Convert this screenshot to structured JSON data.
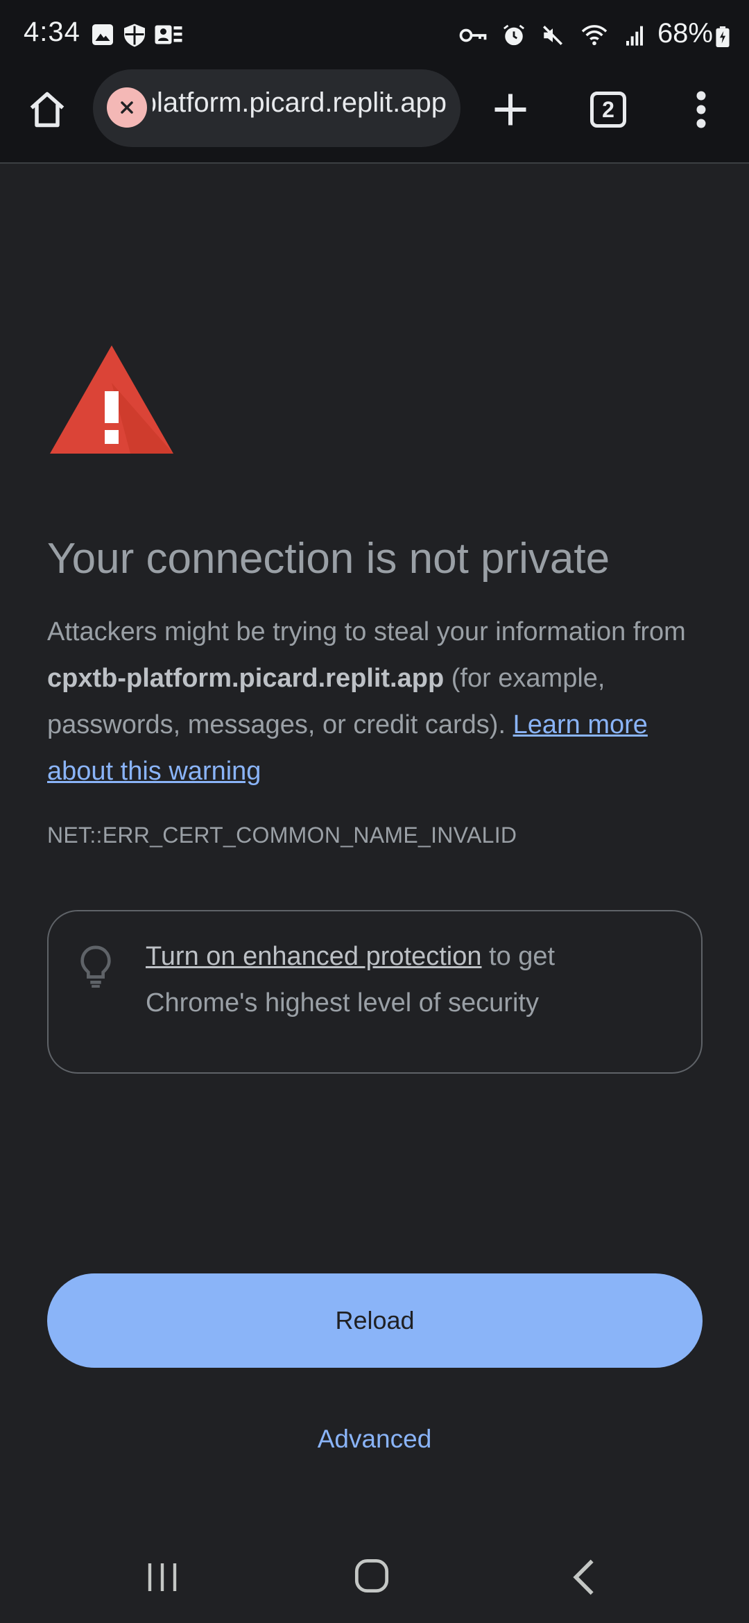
{
  "status_bar": {
    "time": "4:34",
    "battery": "68%",
    "left_icons": [
      "gallery-icon",
      "shield-icon",
      "account-icon"
    ],
    "right_icons": [
      "vpn-key-icon",
      "alarm-icon",
      "mute-icon",
      "wifi-icon",
      "signal-icon",
      "battery-icon"
    ]
  },
  "toolbar": {
    "url": "cpxtb-platform.picard.replit.app",
    "tab_count": "2"
  },
  "page": {
    "title": "Your connection is not private",
    "desc_prefix": "Attackers might be trying to steal your information from ",
    "domain": "cpxtb-platform.picard.replit.app",
    "desc_suffix": " (for example, passwords, messages, or credit cards). ",
    "learn_more": "Learn more about this warning",
    "error_code": "NET::ERR_CERT_COMMON_NAME_INVALID",
    "enhanced_link": "Turn on enhanced protection",
    "enhanced_suffix": " to get Chrome's highest level of security",
    "reload_label": "Reload",
    "advanced_label": "Advanced"
  },
  "colors": {
    "background": "#202124",
    "accent": "#8ab4f8",
    "warning_red": "#db4437",
    "text_secondary": "#9aa0a6"
  }
}
